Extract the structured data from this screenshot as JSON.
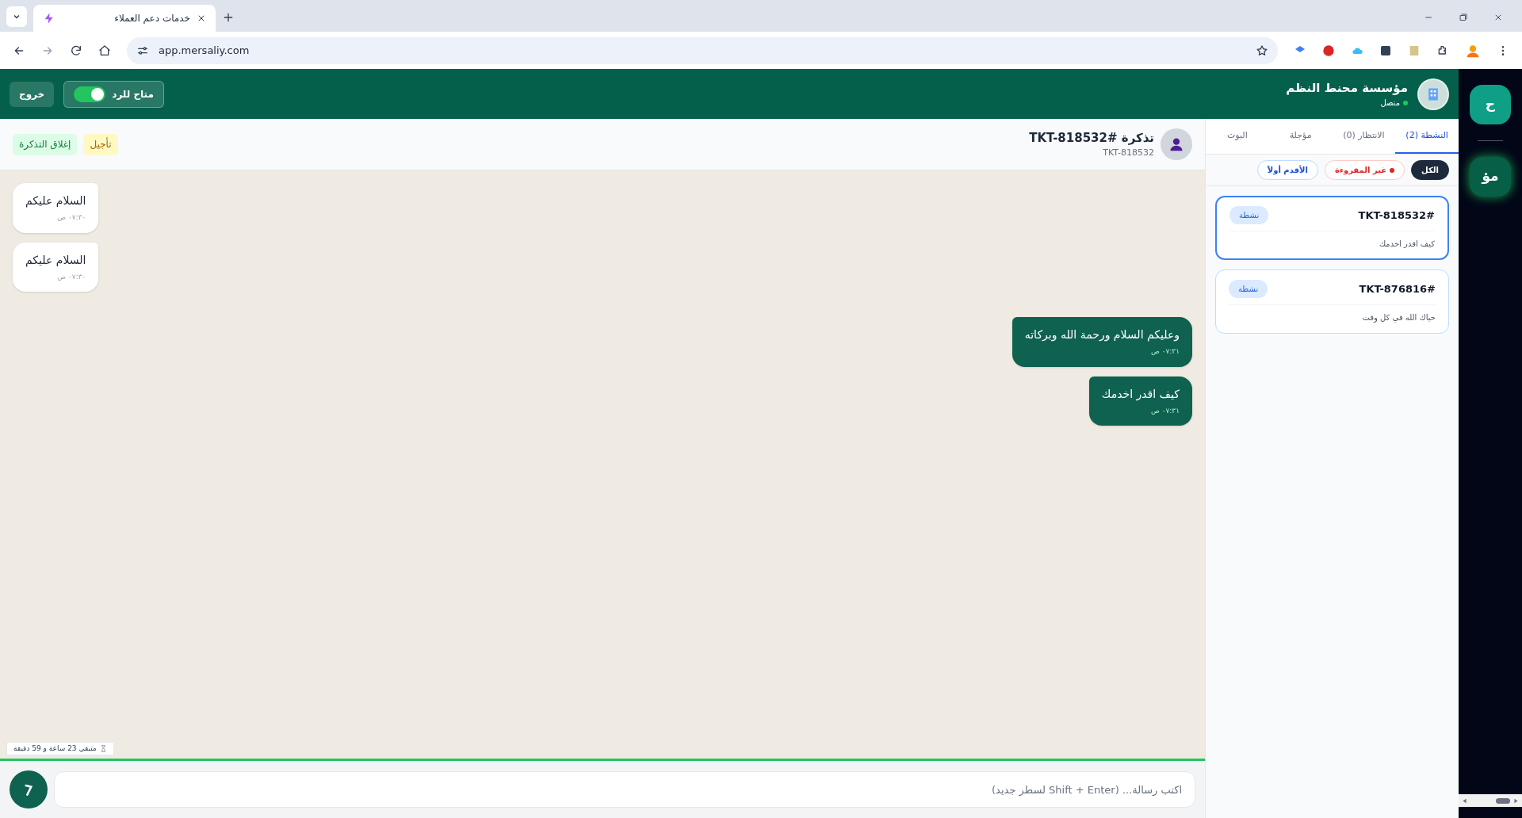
{
  "browser": {
    "tab_title": "خدمات دعم العملاء",
    "url": "app.mersaliy.com"
  },
  "header": {
    "org_name": "مؤسسة محنط النظم",
    "status": "متصل",
    "available_label": "متاح للرد",
    "available_on": true,
    "logout": "خروج"
  },
  "chat": {
    "title": "تذكرة #TKT-818532",
    "subtitle": "TKT-818532",
    "postpone": "تأجيل",
    "close_ticket": "إغلاق التذكرة",
    "messages": [
      {
        "kind": "incoming",
        "text": "السلام عليكم",
        "time": "٠٧:٣٠ ص"
      },
      {
        "kind": "incoming",
        "text": "السلام عليكم",
        "time": "٠٧:٣٠ ص"
      },
      {
        "kind": "outgoing",
        "text": "وعليكم السلام ورحمة الله وبركاته",
        "time": "٠٧:٣١ ص"
      },
      {
        "kind": "outgoing",
        "text": "كيف اقدر اخدمك",
        "time": "٠٧:٣١ ص"
      }
    ],
    "timer": "متبقي 23 ساعة و 59 دقيقة",
    "input": {
      "placeholder": "اكتب رسالة... (Shift + Enter لسطر جديد)"
    }
  },
  "tickets_panel": {
    "tabs": [
      {
        "label": "النشطة (2)",
        "selected": true
      },
      {
        "label": "الانتظار (0)",
        "selected": false
      },
      {
        "label": "مؤجلة",
        "selected": false
      },
      {
        "label": "البوت",
        "selected": false
      }
    ],
    "filters": [
      {
        "kind": "all",
        "label": "الكل",
        "selected": true
      },
      {
        "kind": "unread",
        "label": "غير المقروءة",
        "selected": false
      },
      {
        "kind": "sort",
        "label": "الأقدم أولاً",
        "selected": false
      }
    ],
    "tickets": [
      {
        "id": "TKT-818532#",
        "status": "نشطة",
        "preview": "كيف اقدر اخدمك",
        "selected": true
      },
      {
        "id": "TKT-876816#",
        "status": "نشطة",
        "preview": "حياك الله في كل وقت",
        "selected": false
      }
    ]
  },
  "rail": [
    {
      "label": "ح",
      "selected": false
    },
    {
      "label": "مؤ",
      "selected": true
    }
  ]
}
